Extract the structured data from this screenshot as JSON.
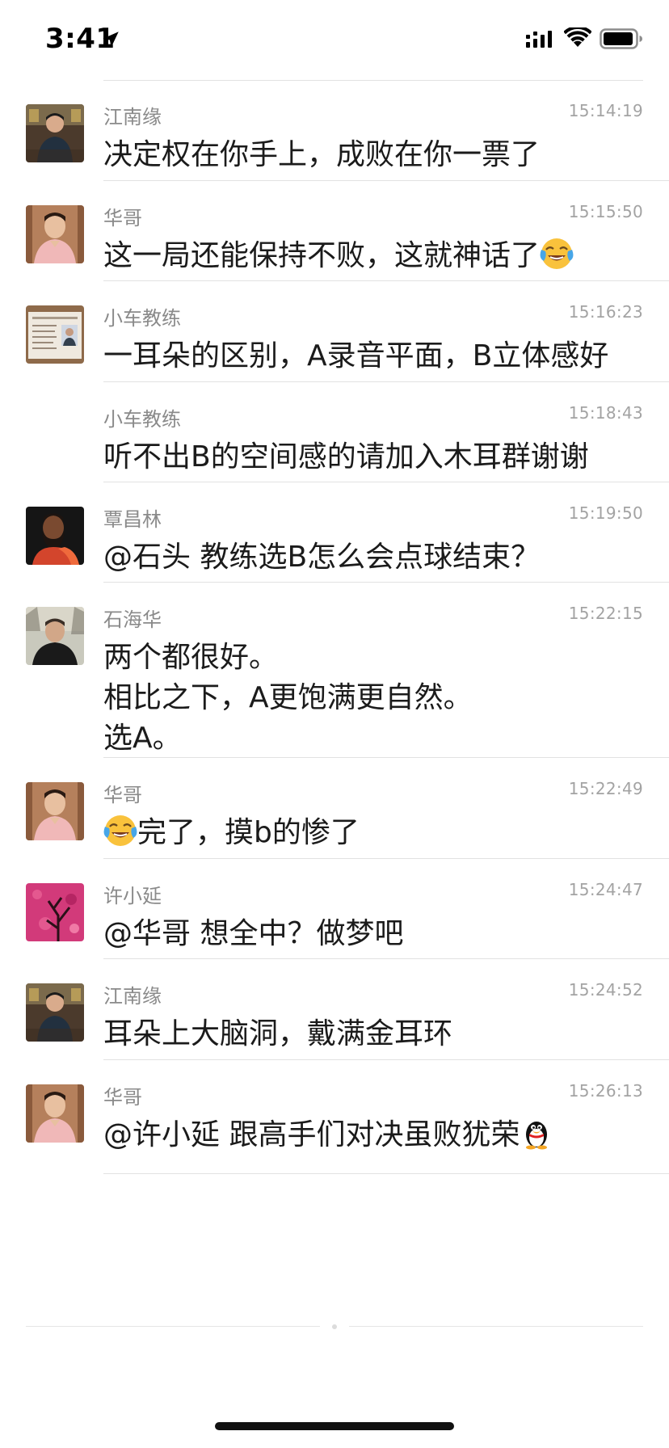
{
  "status_bar": {
    "time": "3:41",
    "icons": [
      "location-arrow-icon",
      "cellular-signal-icon",
      "wifi-icon",
      "battery-icon"
    ]
  },
  "messages": [
    {
      "sender": "江南缘",
      "time": "15:14:19",
      "text": "决定权在你手上，成败在你一票了",
      "avatar": "photo-man-dark-shirt"
    },
    {
      "sender": "华哥",
      "time": "15:15:50",
      "text": "这一局还能保持不败，这就神话了",
      "avatar": "photo-man-pink-shirt",
      "trailing_emoji": "crying-laughing-face-icon"
    },
    {
      "sender": "小车教练",
      "time": "15:16:23",
      "text": "一耳朵的区别，A录音平面，B立体感好",
      "avatar": "photo-id-document"
    },
    {
      "sender": "小车教练",
      "time": "15:18:43",
      "text": "听不出B的空间感的请加入木耳群谢谢",
      "avatar": ""
    },
    {
      "sender": "覃昌林",
      "time": "15:19:50",
      "text": "@石头 教练选B怎么会点球结束？",
      "avatar": "photo-bearded-man-red-jacket"
    },
    {
      "sender": "石海华",
      "time": "15:22:15",
      "text": "两个都很好。\n相比之下，A更饱满更自然。\n选A。",
      "avatar": "photo-man-outdoor"
    },
    {
      "sender": "华哥",
      "time": "15:22:49",
      "text": "完了，摸b的惨了",
      "avatar": "photo-man-pink-shirt",
      "leading_emoji": "crying-laughing-face-icon"
    },
    {
      "sender": "许小延",
      "time": "15:24:47",
      "text": "@华哥 想全中？做梦吧",
      "avatar": "photo-pink-tree"
    },
    {
      "sender": "江南缘",
      "time": "15:24:52",
      "text": "耳朵上大脑洞，戴满金耳环",
      "avatar": "photo-man-dark-shirt"
    },
    {
      "sender": "华哥",
      "time": "15:26:13",
      "text": "@许小延 跟高手们对决虽败犹荣",
      "avatar": "photo-man-pink-shirt",
      "trailing_emoji": "penguin-icon"
    }
  ]
}
